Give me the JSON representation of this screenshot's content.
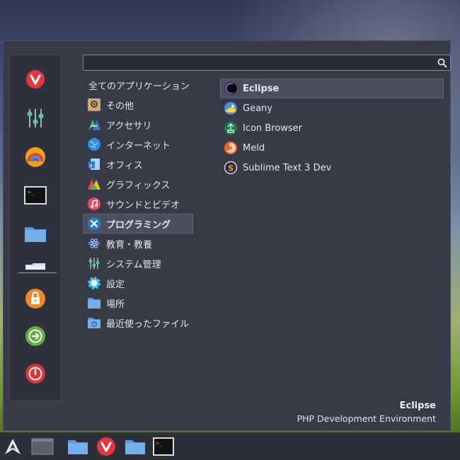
{
  "search": {
    "placeholder": ""
  },
  "favorites": [
    {
      "name": "vivaldi-icon"
    },
    {
      "name": "mixer-icon"
    },
    {
      "name": "rainbow-icon"
    },
    {
      "name": "terminal-icon"
    },
    {
      "name": "folder-icon"
    },
    {
      "name": "home-folder-icon"
    },
    {
      "name": "lock-icon"
    },
    {
      "name": "logout-icon"
    },
    {
      "name": "power-icon"
    }
  ],
  "categories": {
    "all_label": "全てのアプリケーション",
    "items": [
      {
        "label": "その他",
        "icon": "other-icon"
      },
      {
        "label": "アクセサリ",
        "icon": "accessories-icon"
      },
      {
        "label": "インターネット",
        "icon": "internet-icon"
      },
      {
        "label": "オフィス",
        "icon": "office-icon"
      },
      {
        "label": "グラフィックス",
        "icon": "graphics-icon"
      },
      {
        "label": "サウンドとビデオ",
        "icon": "sound-video-icon"
      },
      {
        "label": "プログラミング",
        "icon": "programming-icon",
        "selected": true
      },
      {
        "label": "教育・教養",
        "icon": "education-icon"
      },
      {
        "label": "システム管理",
        "icon": "system-icon"
      },
      {
        "label": "設定",
        "icon": "settings-icon"
      },
      {
        "label": "場所",
        "icon": "places-icon"
      },
      {
        "label": "最近使ったファイル",
        "icon": "recent-files-icon"
      }
    ]
  },
  "apps": [
    {
      "label": "Eclipse",
      "icon": "eclipse-icon",
      "selected": true
    },
    {
      "label": "Geany",
      "icon": "geany-icon"
    },
    {
      "label": "Icon Browser",
      "icon": "icon-browser-icon"
    },
    {
      "label": "Meld",
      "icon": "meld-icon"
    },
    {
      "label": "Sublime Text 3 Dev",
      "icon": "sublime-icon"
    }
  ],
  "description": {
    "title": "Eclipse",
    "subtitle": "PHP Development Environment"
  },
  "taskbar": [
    {
      "name": "app-menu-icon"
    },
    {
      "name": "show-desktop-icon"
    },
    {
      "name": "files-icon"
    },
    {
      "name": "vivaldi-icon"
    },
    {
      "name": "folder-icon"
    },
    {
      "name": "terminal-icon"
    }
  ]
}
